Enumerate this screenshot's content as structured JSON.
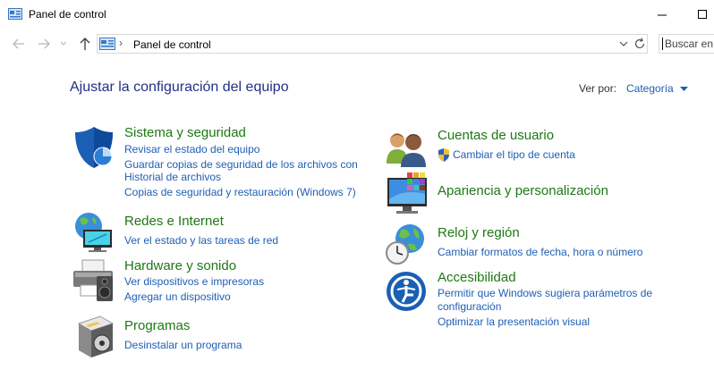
{
  "window": {
    "title": "Panel de control"
  },
  "address": {
    "separator": "›",
    "path": "Panel de control"
  },
  "search": {
    "placeholder": "Buscar en"
  },
  "main": {
    "title": "Ajustar la configuración del equipo",
    "view_by_label": "Ver por:",
    "view_by_value": "Categoría"
  },
  "categories": {
    "system": {
      "title": "Sistema y seguridad",
      "links": [
        "Revisar el estado del equipo",
        "Guardar copias de seguridad de los archivos con",
        "Historial de archivos",
        "Copias de seguridad y restauración (Windows 7)"
      ]
    },
    "network": {
      "title": "Redes e Internet",
      "links": [
        "Ver el estado y las tareas de red"
      ]
    },
    "hardware": {
      "title": "Hardware y sonido",
      "links": [
        "Ver dispositivos e impresoras",
        "Agregar un dispositivo"
      ]
    },
    "programs": {
      "title": "Programas",
      "links": [
        "Desinstalar un programa"
      ]
    },
    "accounts": {
      "title": "Cuentas de usuario",
      "links": [
        "Cambiar el tipo de cuenta"
      ]
    },
    "appearance": {
      "title": "Apariencia y personalización",
      "links": []
    },
    "clock": {
      "title": "Reloj y región",
      "links": [
        "Cambiar formatos de fecha, hora o número"
      ]
    },
    "ease": {
      "title": "Accesibilidad",
      "links": [
        "Permitir que Windows sugiera parámetros de",
        "configuración",
        "Optimizar la presentación visual"
      ]
    }
  },
  "colors": {
    "title_blue": "#1e3287",
    "link_blue": "#1e5fb4",
    "category_green": "#1e7814"
  }
}
